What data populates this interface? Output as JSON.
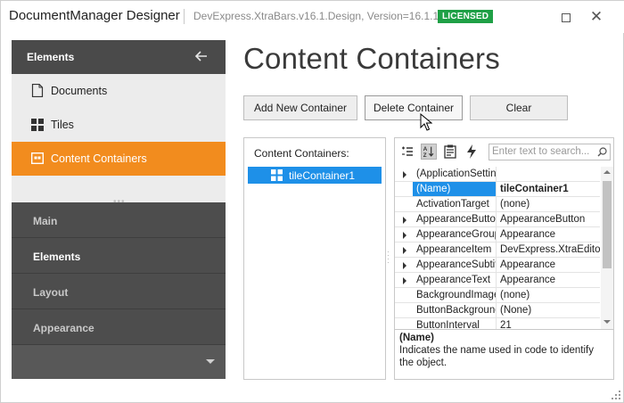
{
  "window": {
    "title": "DocumentManager Designer",
    "subtitle": "DevExpress.XtraBars.v16.1.Design, Version=16.1.1.0",
    "badge": "LICENSED",
    "badge_color": "#1fa046",
    "maximize_icon": "maximize-icon",
    "close_icon": "close-icon",
    "close_glyph": "✕"
  },
  "sidebar": {
    "header": "Elements",
    "back_icon": "arrow-left-icon",
    "items": [
      {
        "label": "Documents",
        "icon": "document-icon",
        "active": false
      },
      {
        "label": "Tiles",
        "icon": "tiles-icon",
        "active": false
      },
      {
        "label": "Content Containers",
        "icon": "container-icon",
        "active": true
      }
    ],
    "accent_color": "#f28c1e",
    "groups": [
      {
        "label": "Main",
        "active": false
      },
      {
        "label": "Elements",
        "active": true
      },
      {
        "label": "Layout",
        "active": false
      },
      {
        "label": "Appearance",
        "active": false
      }
    ]
  },
  "main": {
    "title": "Content Containers",
    "buttons": {
      "add": "Add New Container",
      "delete": "Delete Container",
      "clear": "Clear"
    },
    "containers_label": "Content Containers:",
    "containers": [
      {
        "name": "tileContainer1",
        "selected": true
      }
    ],
    "selection_color": "#1e90e8"
  },
  "property_grid": {
    "search_placeholder": "Enter text to search...",
    "toolbar_icons": [
      "categorized-icon",
      "alphabetical-icon",
      "properties-icon",
      "events-icon"
    ],
    "rows": [
      {
        "name": "(ApplicationSetting",
        "value": "",
        "expandable": true,
        "selected": false
      },
      {
        "name": "(Name)",
        "value": "tileContainer1",
        "expandable": false,
        "selected": true
      },
      {
        "name": "ActivationTarget",
        "value": "(none)",
        "expandable": false,
        "selected": false
      },
      {
        "name": "AppearanceButton",
        "value": "AppearanceButton",
        "expandable": true,
        "selected": false
      },
      {
        "name": "AppearanceGroupT",
        "value": "Appearance",
        "expandable": true,
        "selected": false
      },
      {
        "name": "AppearanceItem",
        "value": "DevExpress.XtraEditor",
        "expandable": true,
        "selected": false
      },
      {
        "name": "AppearanceSubtitle",
        "value": "Appearance",
        "expandable": true,
        "selected": false
      },
      {
        "name": "AppearanceText",
        "value": "Appearance",
        "expandable": true,
        "selected": false
      },
      {
        "name": "BackgroundImage",
        "value": "(none)",
        "expandable": false,
        "selected": false
      },
      {
        "name": "ButtonBackground",
        "value": "(None)",
        "expandable": false,
        "selected": false
      },
      {
        "name": "ButtonInterval",
        "value": "21",
        "expandable": false,
        "selected": false
      }
    ],
    "description_title": "(Name)",
    "description_text": "Indicates the name used in code to identify the object."
  }
}
